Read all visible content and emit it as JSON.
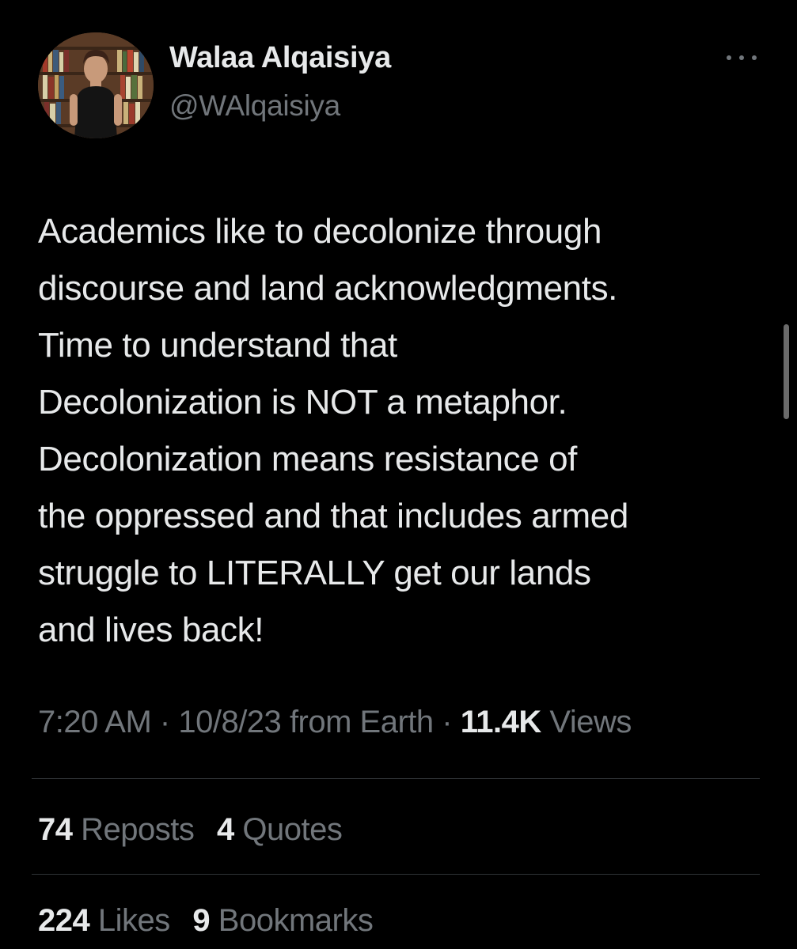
{
  "author": {
    "display_name": "Walaa Alqaisiya",
    "handle": "@WAlqaisiya"
  },
  "tweet": {
    "text_lines": [
      "Academics like to decolonize through",
      "discourse and land acknowledgments.",
      "Time to understand that",
      "Decolonization is NOT a metaphor.",
      "Decolonization means resistance of",
      "the oppressed and that includes armed",
      "struggle to LITERALLY get our lands",
      "and lives back!"
    ],
    "time": "7:20 AM",
    "separator": "·",
    "date": "10/8/23",
    "source": "from Earth",
    "views_count": "11.4K",
    "views_label": "Views"
  },
  "stats": {
    "reposts_count": "74",
    "reposts_label": "Reposts",
    "quotes_count": "4",
    "quotes_label": "Quotes",
    "likes_count": "224",
    "likes_label": "Likes",
    "bookmarks_count": "9",
    "bookmarks_label": "Bookmarks"
  },
  "icons": {
    "more": "more-horizontal-icon"
  },
  "colors": {
    "background": "#000000",
    "text_primary": "#e7e9ea",
    "text_secondary": "#71767b",
    "divider": "#2f3336"
  }
}
